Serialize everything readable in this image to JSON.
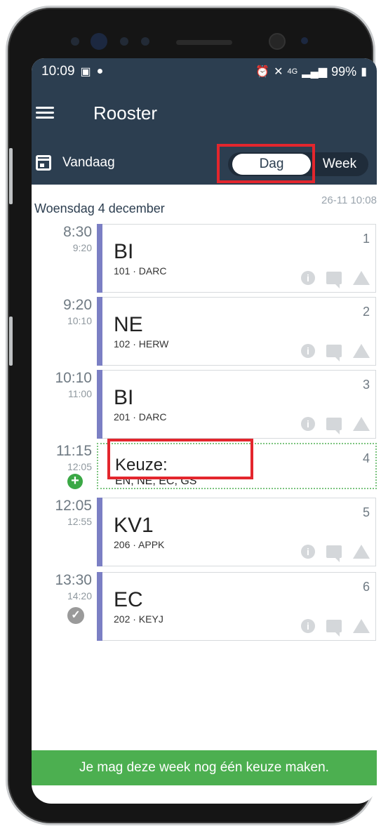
{
  "status_bar": {
    "time": "10:09",
    "battery": "99%",
    "left_icons": [
      "image-icon",
      "spotify-icon"
    ],
    "right_icons": [
      "alarm-icon",
      "mute-icon",
      "4g-icon",
      "signal-icon",
      "battery-icon"
    ]
  },
  "app_bar": {
    "title": "Rooster",
    "menu_icon": "hamburger-icon"
  },
  "sub_bar": {
    "today_label": "Vandaag",
    "calendar_icon": "calendar-icon",
    "toggle": {
      "options": [
        "Dag",
        "Week"
      ],
      "selected": "Dag"
    }
  },
  "day": {
    "date_label": "Woensdag 4 december",
    "updated": "26-11 10:08"
  },
  "lessons": [
    {
      "start": "8:30",
      "end": "9:20",
      "subject": "BI",
      "room": "101 · DARC",
      "period": "1"
    },
    {
      "start": "9:20",
      "end": "10:10",
      "subject": "NE",
      "room": "102 · HERW",
      "period": "2"
    },
    {
      "start": "10:10",
      "end": "11:00",
      "subject": "BI",
      "room": "201 · DARC",
      "period": "3"
    },
    {
      "start": "11:15",
      "end": "12:05",
      "subject": "Keuze:",
      "room": "EN, NE, EC, GS",
      "period": "4",
      "badge": "+"
    },
    {
      "start": "12:05",
      "end": "12:55",
      "subject": "KV1",
      "room": "206 · APPK",
      "period": "5"
    },
    {
      "start": "13:30",
      "end": "14:20",
      "subject": "EC",
      "room": "202 · KEYJ",
      "period": "6",
      "badge": "✓"
    }
  ],
  "footer": {
    "message": "Je mag deze week nog één keuze maken."
  },
  "colors": {
    "header": "#2c3e50",
    "lesson_bar": "#7b7fc4",
    "highlight": "#e3262d",
    "footer": "#4caf50"
  }
}
